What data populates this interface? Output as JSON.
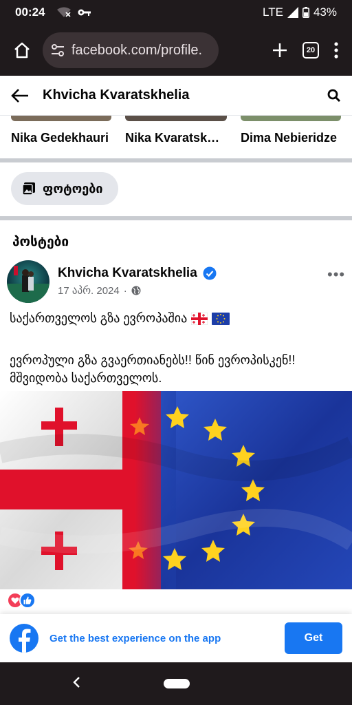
{
  "status_bar": {
    "time": "00:24",
    "network": "LTE",
    "battery": "43%"
  },
  "browser": {
    "url": "facebook.com/profile.",
    "tabs_count": "20"
  },
  "header": {
    "title": "Khvicha Kvaratskhelia"
  },
  "friends": [
    {
      "name": "Nika Gedekhauri"
    },
    {
      "name": "Nika Kvaratskhelia"
    },
    {
      "name": "Dima Nebieridze"
    }
  ],
  "photos": {
    "label": "ფოტოები"
  },
  "posts": {
    "title": "პოსტები",
    "post": {
      "author": "Khvicha Kvaratskhelia",
      "date": "17 აპრ. 2024",
      "separator": "·",
      "text_line1": "საქართველოს გზა ევროპაშია",
      "text_line2": "ევროპული გზა გვაერთიანებს!! წინ ევროპისკენ!! მშვიდობა საქართველოს."
    }
  },
  "app_banner": {
    "text": "Get the best experience on the app",
    "button": "Get"
  },
  "colors": {
    "fb_blue": "#1877f2",
    "system_bar": "#1f1a1c",
    "love": "#f33e58",
    "eu_blue": "#1d3ea8",
    "eu_star": "#ffd21f",
    "georgia_red": "#e0112b"
  }
}
